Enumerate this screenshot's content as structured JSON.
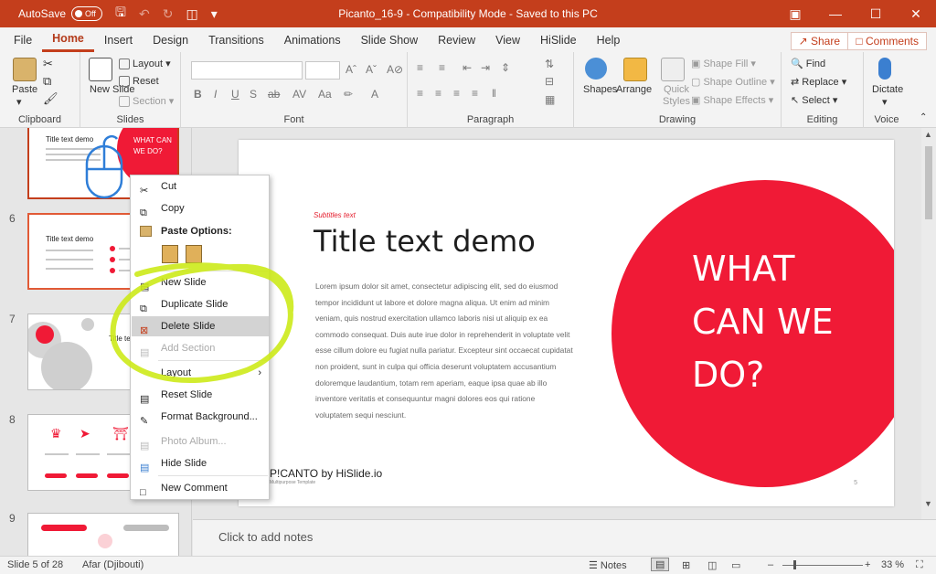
{
  "titlebar": {
    "autosave_label": "AutoSave",
    "autosave_state": "Off",
    "document_title": "Picanto_16-9  -  Compatibility Mode  -  Saved to this PC"
  },
  "menu": {
    "tabs": [
      "File",
      "Home",
      "Insert",
      "Design",
      "Transitions",
      "Animations",
      "Slide Show",
      "Review",
      "View",
      "HiSlide",
      "Help"
    ],
    "active_tab": "Home",
    "share_label": "Share",
    "comments_label": "Comments"
  },
  "ribbon": {
    "clipboard": {
      "label": "Clipboard",
      "paste": "Paste"
    },
    "slides": {
      "label": "Slides",
      "new_slide": "New Slide",
      "layout": "Layout",
      "reset": "Reset",
      "section": "Section"
    },
    "font": {
      "label": "Font"
    },
    "paragraph": {
      "label": "Paragraph"
    },
    "drawing": {
      "label": "Drawing",
      "shapes": "Shapes",
      "arrange": "Arrange",
      "quick_styles": "Quick Styles",
      "shape_fill": "Shape Fill",
      "shape_outline": "Shape Outline",
      "shape_effects": "Shape Effects"
    },
    "editing": {
      "label": "Editing",
      "find": "Find",
      "replace": "Replace",
      "select": "Select"
    },
    "voice": {
      "label": "Voice",
      "dictate": "Dictate"
    }
  },
  "thumbnails": {
    "slide5_title": "Title text demo",
    "slide5_circle_text": "WHAT CAN WE DO?",
    "slide6_number": "6",
    "slide6_title": "Title text demo",
    "slide7_number": "7",
    "slide7_title": "Title te",
    "slide8_number": "8",
    "slide9_number": "9"
  },
  "slide": {
    "subtitle": "Subtitles text",
    "title": "Title text demo",
    "body": "Lorem ipsum dolor sit amet, consectetur adipiscing elit, sed do eiusmod tempor incididunt ut labore et dolore magna aliqua. Ut enim ad minim veniam, quis nostrud exercitation ullamco laboris nisi ut aliquip ex ea commodo consequat. Duis aute irue dolor in reprehenderit in voluptate velit esse cillum dolore eu fugiat nulla pariatur. Excepteur sint occaecat cupidatat non proident, sunt in culpa qui officia deserunt voluptatem accusantium doloremque laudantium, totam rem aperiam, eaque ipsa quae ab illo inventore veritatis et consequuntur magni dolores eos qui ratione voluptatem sequi nesciunt.",
    "circle_text": "WHAT CAN WE DO?",
    "brand": "P!CANTO by HiSlide.io",
    "brand_sub": "Multipurpose Template",
    "page_number": "5"
  },
  "context_menu": {
    "cut": "Cut",
    "copy": "Copy",
    "paste_options": "Paste Options:",
    "new_slide": "New Slide",
    "duplicate_slide": "Duplicate Slide",
    "delete_slide": "Delete Slide",
    "add_section": "Add Section",
    "layout": "Layout",
    "reset_slide": "Reset Slide",
    "format_background": "Format Background...",
    "photo_album": "Photo Album...",
    "hide_slide": "Hide Slide",
    "new_comment": "New Comment"
  },
  "notes_placeholder": "Click to add notes",
  "status": {
    "slide_counter": "Slide 5 of 28",
    "language": "Afar (Djibouti)",
    "notes_label": "Notes",
    "zoom": "33 %"
  },
  "colors": {
    "accent": "#c43e1c",
    "brand_red": "#f01a36",
    "highlight": "#cdea1a"
  }
}
